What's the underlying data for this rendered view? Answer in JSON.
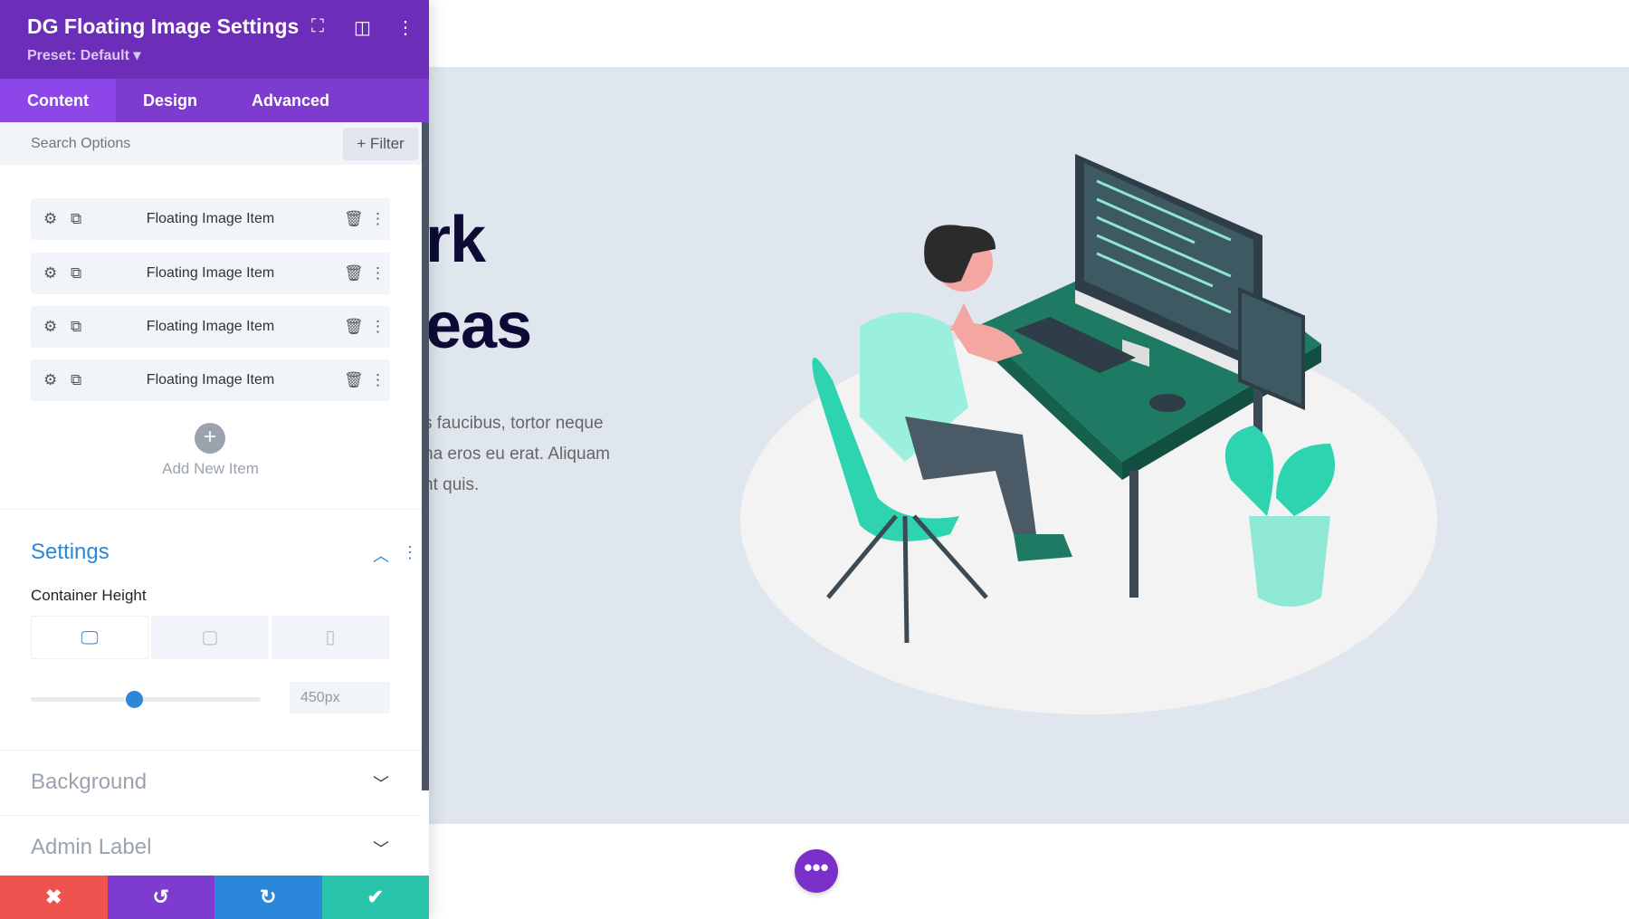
{
  "panel": {
    "title": "DG Floating Image Settings",
    "preset": "Preset: Default ▾",
    "tabs": [
      {
        "label": "Content"
      },
      {
        "label": "Design"
      },
      {
        "label": "Advanced"
      }
    ],
    "active_tab": "Content",
    "search_placeholder": "Search Options",
    "filter_label": "+ Filter",
    "items": [
      {
        "label": "Floating Image Item"
      },
      {
        "label": "Floating Image Item"
      },
      {
        "label": "Floating Image Item"
      },
      {
        "label": "Floating Image Item"
      }
    ],
    "add_new_item": "Add New Item",
    "settings": {
      "title": "Settings",
      "container_height_label": "Container Height",
      "value": "450px",
      "slider_percent": 45,
      "active_device": "desktop"
    },
    "background_label": "Background",
    "admin_label": "Admin Label",
    "colors": {
      "header": "#6c2eb9",
      "cancel": "#ef5350",
      "undo": "#7e3bd0",
      "redo": "#2b87da",
      "save": "#29c4a9"
    }
  },
  "page": {
    "heading_line1": "rk",
    "heading_line2": "eas",
    "body": [
      "s faucibus, tortor neque",
      "na eros eu erat. Aliquam",
      "nt quis."
    ],
    "more_button": "•••"
  }
}
